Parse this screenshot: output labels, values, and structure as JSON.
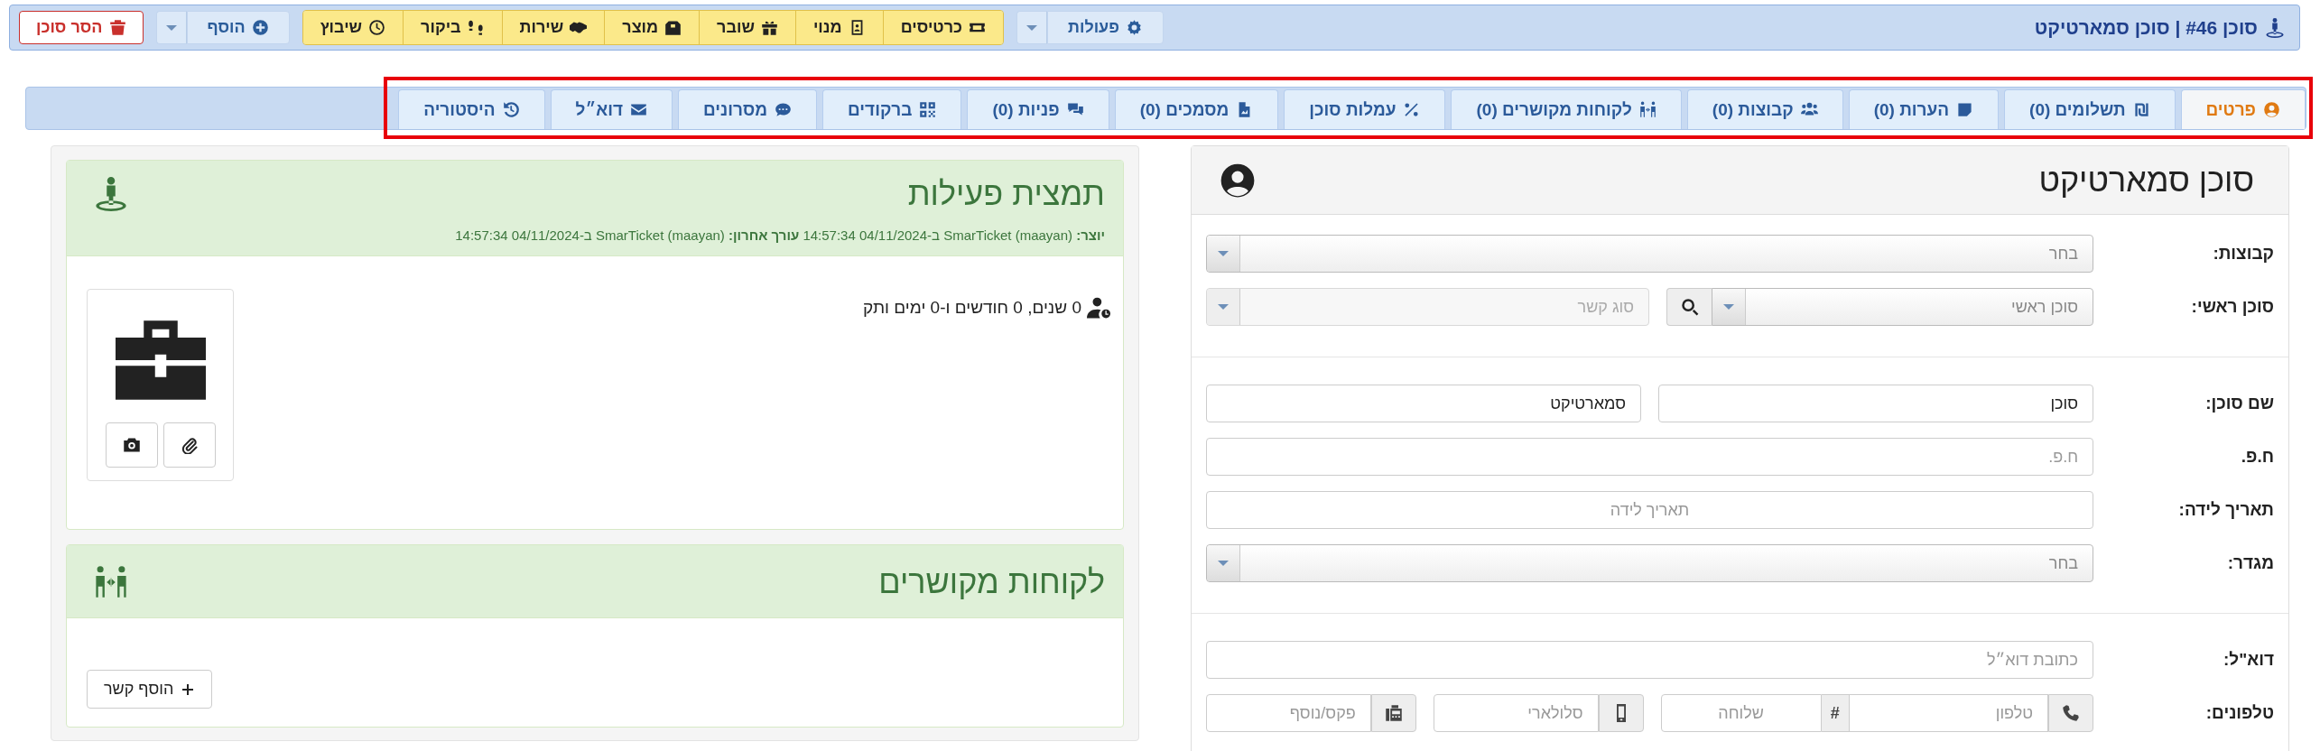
{
  "header": {
    "title": "סוכן #46 | סוכן סמארטיקט"
  },
  "toolbar": {
    "actions": "פעולות",
    "quick_buttons": [
      "כרטיסים",
      "מנוי",
      "שובר",
      "מוצר",
      "שירות",
      "ביקור",
      "שיבוץ"
    ],
    "add": "הוסף",
    "remove": "הסר סוכן"
  },
  "tabs": [
    {
      "label": "פרטים",
      "selected": true
    },
    {
      "label": "תשלומים (0)",
      "selected": false
    },
    {
      "label": "הערות (0)",
      "selected": false
    },
    {
      "label": "קבוצות (0)",
      "selected": false
    },
    {
      "label": "לקוחות מקושרים (0)",
      "selected": false
    },
    {
      "label": "עמלות סוכן",
      "selected": false
    },
    {
      "label": "מסמכים (0)",
      "selected": false
    },
    {
      "label": "פניות (0)",
      "selected": false
    },
    {
      "label": "ברקודים",
      "selected": false
    },
    {
      "label": "מסרונים",
      "selected": false
    },
    {
      "label": "דוא״ל",
      "selected": false
    },
    {
      "label": "היסטוריה",
      "selected": false
    }
  ],
  "details": {
    "title": "סוכן סמארטיקט",
    "sections": [
      [
        {
          "label": "קבוצות:",
          "fields": [
            {
              "kind": "select",
              "placeholder": "בחר",
              "disabled": false
            }
          ]
        },
        {
          "label": "סוכן ראשי:",
          "fields": [
            {
              "kind": "lookup",
              "placeholder": "סוכן ראשי"
            },
            {
              "kind": "select",
              "placeholder": "סוג קשר",
              "disabled": true
            }
          ]
        }
      ],
      [
        {
          "label": "שם סוכן:",
          "fields": [
            {
              "kind": "input",
              "value": "סוכן"
            },
            {
              "kind": "input",
              "value": "סמארטיקט"
            }
          ]
        },
        {
          "label": "ח.פ.",
          "fields": [
            {
              "kind": "input",
              "placeholder": "ח.פ."
            }
          ]
        },
        {
          "label": "תאריך לידה:",
          "fields": [
            {
              "kind": "date",
              "placeholder": "תאריך לידה"
            }
          ]
        },
        {
          "label": "מגדר:",
          "fields": [
            {
              "kind": "select",
              "placeholder": "בחר",
              "disabled": false
            }
          ]
        }
      ],
      [
        {
          "label": "דוא\"ל:",
          "fields": [
            {
              "kind": "input",
              "placeholder": "כתובת דוא״ל"
            }
          ]
        },
        {
          "label": "טלפונים:",
          "fields": [
            {
              "kind": "phone",
              "placeholder": "טלפון",
              "separator": "#",
              "extension": {
                "placeholder": "שלוחה"
              }
            },
            {
              "kind": "mobile",
              "placeholder": "סלולארי"
            },
            {
              "kind": "fax",
              "placeholder": "פקס/נוסף"
            }
          ]
        }
      ]
    ]
  },
  "activity": {
    "title": "תמצית פעילות",
    "meta": "**יוצר:** SmarTicket (maayan) ב-04/11/2024 14:57:34 **עורך אחרון:** SmarTicket (maayan) ב-04/11/2024 14:57:34",
    "seniority": "0 שנים, 0 חודשים ו-0 ימים ותק"
  },
  "related": {
    "title": "לקוחות מקושרים",
    "add_button": "הוסף קשר"
  }
}
